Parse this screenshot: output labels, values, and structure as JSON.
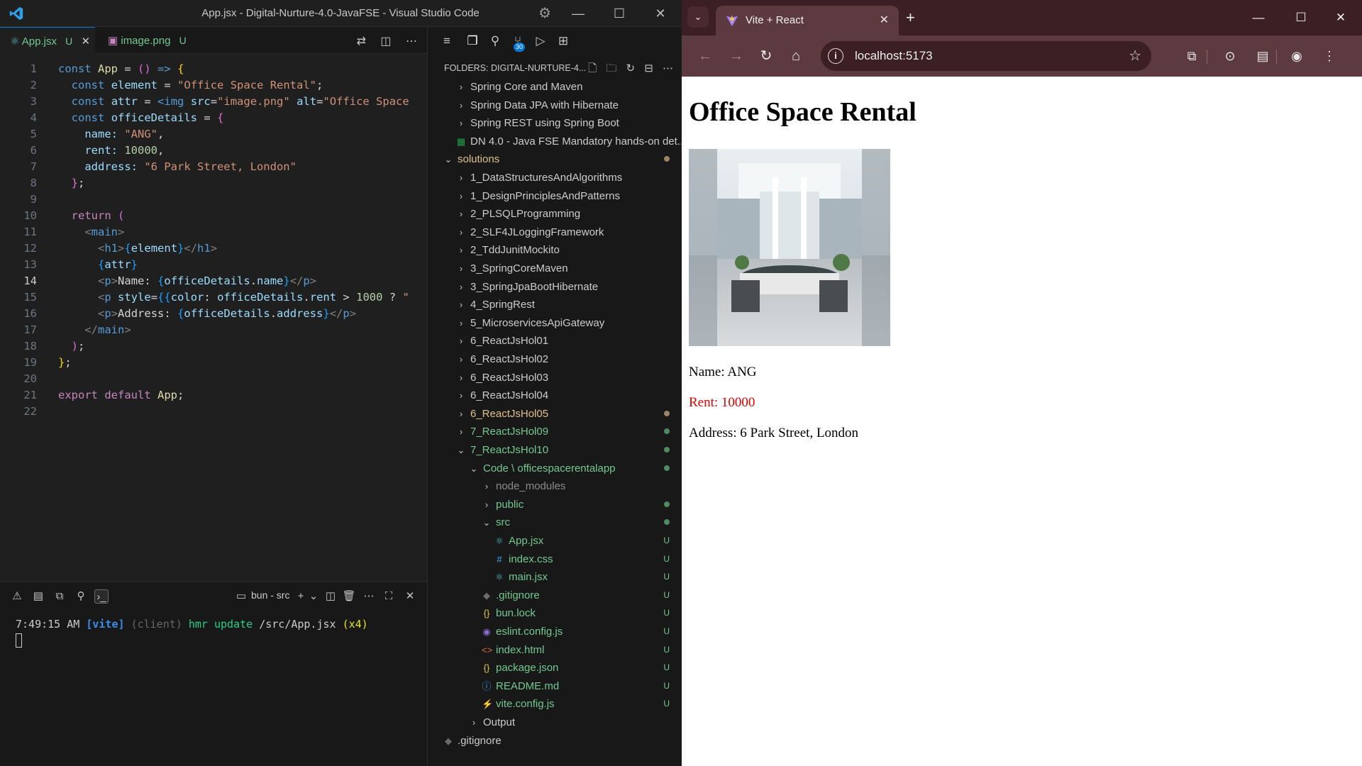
{
  "vscode": {
    "window_title": "App.jsx - Digital-Nurture-4.0-JavaFSE - Visual Studio Code",
    "tabs": [
      {
        "label": "App.jsx",
        "status": "U",
        "active": true
      },
      {
        "label": "image.png",
        "status": "U",
        "active": false
      }
    ],
    "code_lines": [
      {
        "n": "1"
      },
      {
        "n": "2"
      },
      {
        "n": "3"
      },
      {
        "n": "4"
      },
      {
        "n": "5"
      },
      {
        "n": "6"
      },
      {
        "n": "7"
      },
      {
        "n": "8"
      },
      {
        "n": "9"
      },
      {
        "n": "10"
      },
      {
        "n": "11"
      },
      {
        "n": "12"
      },
      {
        "n": "13"
      },
      {
        "n": "14"
      },
      {
        "n": "15"
      },
      {
        "n": "16"
      },
      {
        "n": "17"
      },
      {
        "n": "18"
      },
      {
        "n": "19"
      },
      {
        "n": "20"
      },
      {
        "n": "21"
      },
      {
        "n": "22"
      }
    ],
    "code": {
      "l1": [
        "const",
        "App",
        "=",
        "()",
        "=>",
        "{"
      ],
      "l2": [
        "const",
        "element",
        "=",
        "\"Office Space Rental\"",
        ";"
      ],
      "l3": [
        "const",
        "attr",
        "=",
        "<img",
        "src",
        "=",
        "\"image.png\"",
        "alt",
        "=",
        "\"Office Space"
      ],
      "l4": [
        "const",
        "officeDetails",
        "=",
        "{"
      ],
      "l5": [
        "name:",
        "\"ANG\"",
        ","
      ],
      "l6": [
        "rent:",
        "10000",
        ","
      ],
      "l7": [
        "address:",
        "\"6 Park Street, London\""
      ],
      "l8": [
        "}",
        ";"
      ],
      "l10": [
        "return",
        "("
      ],
      "l11": [
        "<",
        "main",
        ">"
      ],
      "l12": [
        "<",
        "h1",
        ">",
        "{",
        "element",
        "}",
        "</",
        "h1",
        ">"
      ],
      "l13": [
        "{",
        "attr",
        "}"
      ],
      "l14": [
        "<",
        "p",
        ">",
        "Name: ",
        "{",
        "officeDetails",
        ".",
        "name",
        "}",
        "</",
        "p",
        ">"
      ],
      "l15": [
        "<",
        "p",
        "style",
        "=",
        "{{",
        "color",
        ":",
        "officeDetails",
        ".",
        "rent",
        ">",
        "1000",
        "?",
        "\""
      ],
      "l16": [
        "<",
        "p",
        ">",
        "Address: ",
        "{",
        "officeDetails",
        ".",
        "address",
        "}",
        "</",
        "p",
        ">"
      ],
      "l17": [
        "</",
        "main",
        ">"
      ],
      "l18": [
        ")",
        ";"
      ],
      "l19": [
        "}",
        ";"
      ],
      "l21": [
        "export",
        "default",
        "App",
        ";"
      ]
    },
    "terminal": {
      "label": "bun - src",
      "time": "7:49:15 AM",
      "tool": "[vite]",
      "client": "(client)",
      "action": "hmr update",
      "path": "/src/App.jsx",
      "count": "(x4)"
    },
    "explorer": {
      "header": "FOLDERS: DIGITAL-NURTURE-4...",
      "items": [
        {
          "label": "Spring Core and Maven",
          "depth": 1,
          "type": "folder",
          "open": false,
          "color": "default",
          "mark": ""
        },
        {
          "label": "Spring Data JPA with Hibernate",
          "depth": 1,
          "type": "folder",
          "open": false,
          "color": "default",
          "mark": ""
        },
        {
          "label": "Spring REST using Spring Boot",
          "depth": 1,
          "type": "folder",
          "open": false,
          "color": "default",
          "mark": ""
        },
        {
          "label": "DN 4.0 - Java FSE Mandatory hands-on det...",
          "depth": 1,
          "type": "xlsx",
          "open": false,
          "color": "default",
          "mark": ""
        },
        {
          "label": "solutions",
          "depth": 0,
          "type": "folder",
          "open": true,
          "color": "yellow",
          "mark": "dot-y"
        },
        {
          "label": "1_DataStructuresAndAlgorithms",
          "depth": 1,
          "type": "folder",
          "open": false,
          "color": "default",
          "mark": ""
        },
        {
          "label": "1_DesignPrinciplesAndPatterns",
          "depth": 1,
          "type": "folder",
          "open": false,
          "color": "default",
          "mark": ""
        },
        {
          "label": "2_PLSQLProgramming",
          "depth": 1,
          "type": "folder",
          "open": false,
          "color": "default",
          "mark": ""
        },
        {
          "label": "2_SLF4JLoggingFramework",
          "depth": 1,
          "type": "folder",
          "open": false,
          "color": "default",
          "mark": ""
        },
        {
          "label": "2_TddJunitMockito",
          "depth": 1,
          "type": "folder",
          "open": false,
          "color": "default",
          "mark": ""
        },
        {
          "label": "3_SpringCoreMaven",
          "depth": 1,
          "type": "folder",
          "open": false,
          "color": "default",
          "mark": ""
        },
        {
          "label": "3_SpringJpaBootHibernate",
          "depth": 1,
          "type": "folder",
          "open": false,
          "color": "default",
          "mark": ""
        },
        {
          "label": "4_SpringRest",
          "depth": 1,
          "type": "folder",
          "open": false,
          "color": "default",
          "mark": ""
        },
        {
          "label": "5_MicroservicesApiGateway",
          "depth": 1,
          "type": "folder",
          "open": false,
          "color": "default",
          "mark": ""
        },
        {
          "label": "6_ReactJsHol01",
          "depth": 1,
          "type": "folder",
          "open": false,
          "color": "default",
          "mark": ""
        },
        {
          "label": "6_ReactJsHol02",
          "depth": 1,
          "type": "folder",
          "open": false,
          "color": "default",
          "mark": ""
        },
        {
          "label": "6_ReactJsHol03",
          "depth": 1,
          "type": "folder",
          "open": false,
          "color": "default",
          "mark": ""
        },
        {
          "label": "6_ReactJsHol04",
          "depth": 1,
          "type": "folder",
          "open": false,
          "color": "default",
          "mark": ""
        },
        {
          "label": "6_ReactJsHol05",
          "depth": 1,
          "type": "folder",
          "open": false,
          "color": "yellow",
          "mark": "dot-y"
        },
        {
          "label": "7_ReactJsHol09",
          "depth": 1,
          "type": "folder",
          "open": false,
          "color": "green",
          "mark": "dot-g"
        },
        {
          "label": "7_ReactJsHol10",
          "depth": 1,
          "type": "folder",
          "open": true,
          "color": "green",
          "mark": "dot-g"
        },
        {
          "label": "Code \\ officespacerentalapp",
          "depth": 2,
          "type": "folder",
          "open": true,
          "color": "green",
          "mark": "dot-g"
        },
        {
          "label": "node_modules",
          "depth": 3,
          "type": "folder",
          "open": false,
          "color": "dim",
          "mark": ""
        },
        {
          "label": "public",
          "depth": 3,
          "type": "folder",
          "open": false,
          "color": "green",
          "mark": "dot-g"
        },
        {
          "label": "src",
          "depth": 3,
          "type": "folder",
          "open": true,
          "color": "green",
          "mark": "dot-g"
        },
        {
          "label": "App.jsx",
          "depth": 4,
          "type": "react",
          "open": false,
          "color": "green",
          "mark": "U"
        },
        {
          "label": "index.css",
          "depth": 4,
          "type": "css",
          "open": false,
          "color": "green",
          "mark": "U"
        },
        {
          "label": "main.jsx",
          "depth": 4,
          "type": "react",
          "open": false,
          "color": "green",
          "mark": "U"
        },
        {
          "label": ".gitignore",
          "depth": 3,
          "type": "git",
          "open": false,
          "color": "green",
          "mark": "U"
        },
        {
          "label": "bun.lock",
          "depth": 3,
          "type": "json",
          "open": false,
          "color": "green",
          "mark": "U"
        },
        {
          "label": "eslint.config.js",
          "depth": 3,
          "type": "eslint",
          "open": false,
          "color": "green",
          "mark": "U"
        },
        {
          "label": "index.html",
          "depth": 3,
          "type": "html",
          "open": false,
          "color": "green",
          "mark": "U"
        },
        {
          "label": "package.json",
          "depth": 3,
          "type": "json",
          "open": false,
          "color": "green",
          "mark": "U"
        },
        {
          "label": "README.md",
          "depth": 3,
          "type": "info",
          "open": false,
          "color": "green",
          "mark": "U"
        },
        {
          "label": "vite.config.js",
          "depth": 3,
          "type": "vite",
          "open": false,
          "color": "green",
          "mark": "U"
        },
        {
          "label": "Output",
          "depth": 2,
          "type": "folder",
          "open": false,
          "color": "default",
          "mark": ""
        },
        {
          "label": ".gitignore",
          "depth": 0,
          "type": "git",
          "open": false,
          "color": "default",
          "mark": ""
        }
      ]
    },
    "badge_count": "30"
  },
  "browser": {
    "tab_title": "Vite + React",
    "url": "localhost:5173",
    "page": {
      "heading": "Office Space Rental",
      "name_text": "Name: ANG",
      "rent_text": "Rent: 10000",
      "address_text": "Address: 6 Park Street, London",
      "rent_color": "#e00000"
    }
  },
  "colors": {
    "accent": "#0078d4",
    "git_untracked": "#73c991",
    "git_modified": "#e2c08d",
    "browser_frame": "#5c3a40"
  }
}
